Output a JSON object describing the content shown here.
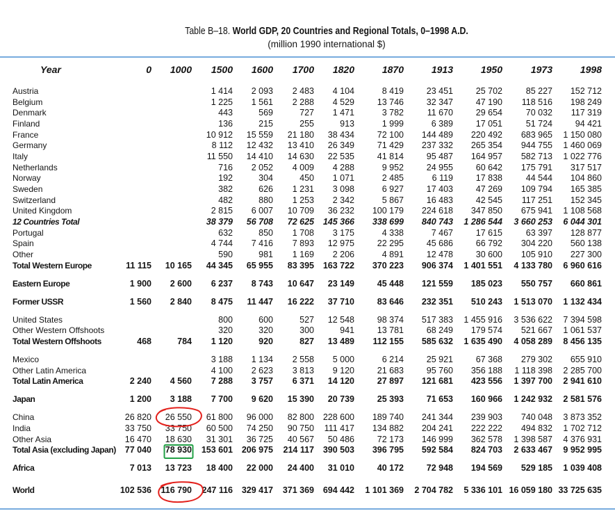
{
  "title": {
    "prefix": "Table B–18.",
    "main": "World GDP, 20 Countries and Regional Totals, 0–1998 A.D.",
    "subtitle": "(million 1990 international $)"
  },
  "colors": {
    "rule": "#4a8fd4",
    "annotation_red": "#e3211c",
    "annotation_green": "#22a045"
  },
  "table": {
    "columns": [
      "Year",
      "0",
      "1000",
      "1500",
      "1600",
      "1700",
      "1820",
      "1870",
      "1913",
      "1950",
      "1973",
      "1998"
    ],
    "groups": [
      {
        "rows": [
          {
            "label": "Austria",
            "values": [
              "",
              "",
              "1 414",
              "2 093",
              "2 483",
              "4 104",
              "8 419",
              "23 451",
              "25 702",
              "85 227",
              "152 712"
            ]
          },
          {
            "label": "Belgium",
            "values": [
              "",
              "",
              "1 225",
              "1 561",
              "2 288",
              "4 529",
              "13 746",
              "32 347",
              "47 190",
              "118 516",
              "198 249"
            ]
          },
          {
            "label": "Denmark",
            "values": [
              "",
              "",
              "443",
              "569",
              "727",
              "1 471",
              "3 782",
              "11 670",
              "29 654",
              "70 032",
              "117 319"
            ]
          },
          {
            "label": "Finland",
            "values": [
              "",
              "",
              "136",
              "215",
              "255",
              "913",
              "1 999",
              "6 389",
              "17 051",
              "51 724",
              "94 421"
            ]
          },
          {
            "label": "France",
            "values": [
              "",
              "",
              "10 912",
              "15 559",
              "21 180",
              "38 434",
              "72 100",
              "144 489",
              "220 492",
              "683 965",
              "1 150 080"
            ]
          },
          {
            "label": "Germany",
            "values": [
              "",
              "",
              "8 112",
              "12 432",
              "13 410",
              "26 349",
              "71 429",
              "237 332",
              "265 354",
              "944 755",
              "1 460 069"
            ]
          },
          {
            "label": "Italy",
            "values": [
              "",
              "",
              "11 550",
              "14 410",
              "14 630",
              "22 535",
              "41 814",
              "95 487",
              "164 957",
              "582 713",
              "1 022 776"
            ]
          },
          {
            "label": "Netherlands",
            "values": [
              "",
              "",
              "716",
              "2 052",
              "4 009",
              "4 288",
              "9 952",
              "24 955",
              "60 642",
              "175 791",
              "317 517"
            ]
          },
          {
            "label": "Norway",
            "values": [
              "",
              "",
              "192",
              "304",
              "450",
              "1 071",
              "2 485",
              "6 119",
              "17 838",
              "44 544",
              "104 860"
            ]
          },
          {
            "label": "Sweden",
            "values": [
              "",
              "",
              "382",
              "626",
              "1 231",
              "3 098",
              "6 927",
              "17 403",
              "47 269",
              "109 794",
              "165 385"
            ]
          },
          {
            "label": "Switzerland",
            "values": [
              "",
              "",
              "482",
              "880",
              "1 253",
              "2 342",
              "5 867",
              "16 483",
              "42 545",
              "117 251",
              "152 345"
            ]
          },
          {
            "label": "United Kingdom",
            "values": [
              "",
              "",
              "2 815",
              "6 007",
              "10 709",
              "36 232",
              "100 179",
              "224 618",
              "347 850",
              "675 941",
              "1 108 568"
            ]
          },
          {
            "label": "12 Countries Total",
            "bold": true,
            "italic": true,
            "values": [
              "",
              "",
              "38 379",
              "56 708",
              "72 625",
              "145 366",
              "338 699",
              "840 743",
              "1 286 544",
              "3 660 253",
              "6 044 301"
            ]
          },
          {
            "label": "Portugal",
            "values": [
              "",
              "",
              "632",
              "850",
              "1 708",
              "3 175",
              "4 338",
              "7 467",
              "17 615",
              "63 397",
              "128 877"
            ]
          },
          {
            "label": "Spain",
            "values": [
              "",
              "",
              "4 744",
              "7 416",
              "7 893",
              "12 975",
              "22 295",
              "45 686",
              "66 792",
              "304 220",
              "560 138"
            ]
          },
          {
            "label": "Other",
            "values": [
              "",
              "",
              "590",
              "981",
              "1 169",
              "2 206",
              "4 891",
              "12 478",
              "30 600",
              "105 910",
              "227 300"
            ]
          },
          {
            "label": "Total Western Europe",
            "bold": true,
            "values": [
              "11 115",
              "10 165",
              "44 345",
              "65 955",
              "83 395",
              "163 722",
              "370 223",
              "906 374",
              "1 401 551",
              "4 133 780",
              "6 960 616"
            ]
          }
        ]
      },
      {
        "rows": [
          {
            "label": "Eastern Europe",
            "bold": true,
            "values": [
              "1 900",
              "2 600",
              "6 237",
              "8 743",
              "10 647",
              "23 149",
              "45 448",
              "121 559",
              "185 023",
              "550 757",
              "660 861"
            ]
          }
        ]
      },
      {
        "rows": [
          {
            "label": "Former USSR",
            "bold": true,
            "values": [
              "1 560",
              "2 840",
              "8 475",
              "11 447",
              "16 222",
              "37 710",
              "83 646",
              "232 351",
              "510 243",
              "1 513 070",
              "1 132 434"
            ]
          }
        ]
      },
      {
        "rows": [
          {
            "label": "United States",
            "values": [
              "",
              "",
              "800",
              "600",
              "527",
              "12 548",
              "98 374",
              "517 383",
              "1 455 916",
              "3 536 622",
              "7 394 598"
            ]
          },
          {
            "label": "Other Western Offshoots",
            "values": [
              "",
              "",
              "320",
              "320",
              "300",
              "941",
              "13 781",
              "68 249",
              "179 574",
              "521 667",
              "1 061 537"
            ]
          },
          {
            "label": "Total Western Offshoots",
            "bold": true,
            "values": [
              "468",
              "784",
              "1 120",
              "920",
              "827",
              "13 489",
              "112 155",
              "585 632",
              "1 635 490",
              "4 058 289",
              "8 456 135"
            ]
          }
        ]
      },
      {
        "rows": [
          {
            "label": "Mexico",
            "values": [
              "",
              "",
              "3 188",
              "1 134",
              "2 558",
              "5 000",
              "6 214",
              "25 921",
              "67 368",
              "279 302",
              "655 910"
            ]
          },
          {
            "label": "Other Latin America",
            "values": [
              "",
              "",
              "4 100",
              "2 623",
              "3 813",
              "9 120",
              "21 683",
              "95 760",
              "356 188",
              "1 118 398",
              "2 285 700"
            ]
          },
          {
            "label": "Total Latin America",
            "bold": true,
            "values": [
              "2 240",
              "4 560",
              "7 288",
              "3 757",
              "6 371",
              "14 120",
              "27 897",
              "121 681",
              "423 556",
              "1 397 700",
              "2 941 610"
            ]
          }
        ]
      },
      {
        "rows": [
          {
            "label": "Japan",
            "bold": true,
            "values": [
              "1 200",
              "3 188",
              "7 700",
              "9 620",
              "15 390",
              "20 739",
              "25 393",
              "71 653",
              "160 966",
              "1 242 932",
              "2 581 576"
            ]
          }
        ]
      },
      {
        "rows": [
          {
            "label": "China",
            "values": [
              "26 820",
              "26 550",
              "61 800",
              "96 000",
              "82 800",
              "228 600",
              "189 740",
              "241 344",
              "239 903",
              "740 048",
              "3 873 352"
            ]
          },
          {
            "label": "India",
            "values": [
              "33 750",
              "33 750",
              "60 500",
              "74 250",
              "90 750",
              "111 417",
              "134 882",
              "204 241",
              "222 222",
              "494 832",
              "1 702 712"
            ]
          },
          {
            "label": "Other Asia",
            "values": [
              "16 470",
              "18 630",
              "31 301",
              "36 725",
              "40 567",
              "50 486",
              "72 173",
              "146 999",
              "362 578",
              "1 398 587",
              "4 376 931"
            ]
          },
          {
            "label": "Total Asia (excluding Japan)",
            "bold": true,
            "values": [
              "77 040",
              "78 930",
              "153 601",
              "206 975",
              "214 117",
              "390 503",
              "396 795",
              "592 584",
              "824 703",
              "2 633 467",
              "9 952 995"
            ]
          }
        ]
      },
      {
        "rows": [
          {
            "label": "Africa",
            "bold": true,
            "values": [
              "7 013",
              "13 723",
              "18 400",
              "22 000",
              "24 400",
              "31 010",
              "40 172",
              "72 948",
              "194 569",
              "529 185",
              "1 039 408"
            ]
          }
        ]
      },
      {
        "rows": [
          {
            "label": "World",
            "bold": true,
            "values": [
              "102 536",
              "116 790",
              "247 116",
              "329 417",
              "371 369",
              "694 442",
              "1 101 369",
              "2 704 782",
              "5 336 101",
              "16 059 180",
              "33 725 635"
            ]
          }
        ]
      }
    ]
  }
}
